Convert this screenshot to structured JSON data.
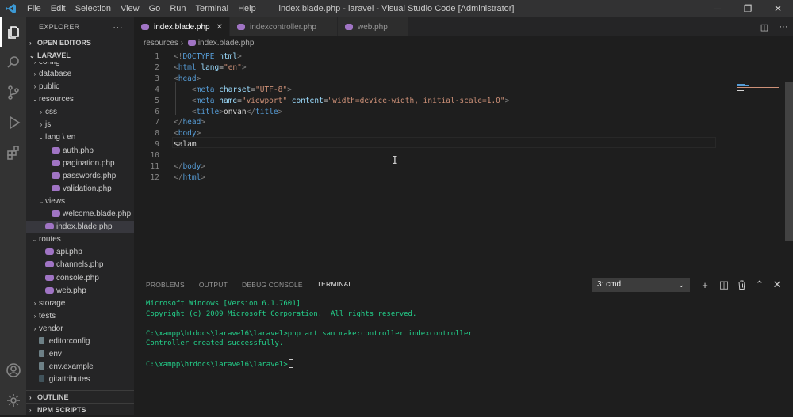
{
  "titlebar": {
    "title": "index.blade.php - laravel - Visual Studio Code [Administrator]",
    "menu": [
      "File",
      "Edit",
      "Selection",
      "View",
      "Go",
      "Run",
      "Terminal",
      "Help"
    ]
  },
  "activity": {
    "icons": [
      "explorer-icon",
      "search-icon",
      "source-control-icon",
      "run-debug-icon",
      "extensions-icon"
    ],
    "bottom_icons": [
      "account-icon",
      "settings-gear-icon"
    ]
  },
  "sidebar": {
    "header": "EXPLORER",
    "more": "···",
    "open_editors": "OPEN EDITORS",
    "project": "LARAVEL",
    "tree": [
      {
        "label": "config",
        "indent": 1,
        "type": "folder",
        "open": false,
        "partial": true
      },
      {
        "label": "database",
        "indent": 1,
        "type": "folder",
        "open": false
      },
      {
        "label": "public",
        "indent": 1,
        "type": "folder",
        "open": false
      },
      {
        "label": "resources",
        "indent": 1,
        "type": "folder",
        "open": true
      },
      {
        "label": "css",
        "indent": 2,
        "type": "folder",
        "open": false
      },
      {
        "label": "js",
        "indent": 2,
        "type": "folder",
        "open": false
      },
      {
        "label": "lang \\ en",
        "indent": 2,
        "type": "folder",
        "open": true
      },
      {
        "label": "auth.php",
        "indent": 3,
        "type": "php"
      },
      {
        "label": "pagination.php",
        "indent": 3,
        "type": "php"
      },
      {
        "label": "passwords.php",
        "indent": 3,
        "type": "php"
      },
      {
        "label": "validation.php",
        "indent": 3,
        "type": "php"
      },
      {
        "label": "views",
        "indent": 2,
        "type": "folder",
        "open": true
      },
      {
        "label": "welcome.blade.php",
        "indent": 3,
        "type": "php"
      },
      {
        "label": "index.blade.php",
        "indent": 2,
        "type": "php",
        "selected": true
      },
      {
        "label": "routes",
        "indent": 1,
        "type": "folder",
        "open": true
      },
      {
        "label": "api.php",
        "indent": 2,
        "type": "php"
      },
      {
        "label": "channels.php",
        "indent": 2,
        "type": "php"
      },
      {
        "label": "console.php",
        "indent": 2,
        "type": "php"
      },
      {
        "label": "web.php",
        "indent": 2,
        "type": "php"
      },
      {
        "label": "storage",
        "indent": 1,
        "type": "folder",
        "open": false
      },
      {
        "label": "tests",
        "indent": 1,
        "type": "folder",
        "open": false
      },
      {
        "label": "vendor",
        "indent": 1,
        "type": "folder",
        "open": false
      },
      {
        "label": ".editorconfig",
        "indent": 1,
        "type": "gear"
      },
      {
        "label": ".env",
        "indent": 1,
        "type": "gear"
      },
      {
        "label": ".env.example",
        "indent": 1,
        "type": "file"
      },
      {
        "label": ".gitattributes",
        "indent": 1,
        "type": "git"
      }
    ],
    "outline": "OUTLINE",
    "npm": "NPM SCRIPTS"
  },
  "tabs": [
    {
      "label": "index.blade.php",
      "active": true,
      "close": "✕"
    },
    {
      "label": "indexcontroller.php",
      "active": false
    },
    {
      "label": "web.php",
      "active": false
    }
  ],
  "breadcrumbs": {
    "folder": "resources",
    "sep": "›",
    "file": "index.blade.php"
  },
  "code_lines": [
    [
      {
        "c": "p",
        "t": "<!"
      },
      {
        "c": "t",
        "t": "DOCTYPE"
      },
      {
        "c": "a",
        "t": " html"
      },
      {
        "c": "p",
        "t": ">"
      }
    ],
    [
      {
        "c": "p",
        "t": "<"
      },
      {
        "c": "t",
        "t": "html"
      },
      {
        "c": "a",
        "t": " lang"
      },
      {
        "c": "tx",
        "t": "="
      },
      {
        "c": "s",
        "t": "\"en\""
      },
      {
        "c": "p",
        "t": ">"
      }
    ],
    [
      {
        "c": "p",
        "t": "<"
      },
      {
        "c": "t",
        "t": "head"
      },
      {
        "c": "p",
        "t": ">"
      }
    ],
    [
      {
        "c": "tx",
        "t": "    "
      },
      {
        "c": "p",
        "t": "<"
      },
      {
        "c": "t",
        "t": "meta"
      },
      {
        "c": "a",
        "t": " charset"
      },
      {
        "c": "tx",
        "t": "="
      },
      {
        "c": "s",
        "t": "\"UTF-8\""
      },
      {
        "c": "p",
        "t": ">"
      }
    ],
    [
      {
        "c": "tx",
        "t": "    "
      },
      {
        "c": "p",
        "t": "<"
      },
      {
        "c": "t",
        "t": "meta"
      },
      {
        "c": "a",
        "t": " name"
      },
      {
        "c": "tx",
        "t": "="
      },
      {
        "c": "s",
        "t": "\"viewport\""
      },
      {
        "c": "a",
        "t": " content"
      },
      {
        "c": "tx",
        "t": "="
      },
      {
        "c": "s",
        "t": "\"width=device-width, initial-scale=1.0\""
      },
      {
        "c": "p",
        "t": ">"
      }
    ],
    [
      {
        "c": "tx",
        "t": "    "
      },
      {
        "c": "p",
        "t": "<"
      },
      {
        "c": "t",
        "t": "title"
      },
      {
        "c": "p",
        "t": ">"
      },
      {
        "c": "tx",
        "t": "onvan"
      },
      {
        "c": "p",
        "t": "</"
      },
      {
        "c": "t",
        "t": "title"
      },
      {
        "c": "p",
        "t": ">"
      }
    ],
    [
      {
        "c": "p",
        "t": "</"
      },
      {
        "c": "t",
        "t": "head"
      },
      {
        "c": "p",
        "t": ">"
      }
    ],
    [
      {
        "c": "p",
        "t": "<"
      },
      {
        "c": "t",
        "t": "body"
      },
      {
        "c": "p",
        "t": ">"
      }
    ],
    [
      {
        "c": "tx",
        "t": "salam"
      }
    ],
    [],
    [
      {
        "c": "p",
        "t": "</"
      },
      {
        "c": "t",
        "t": "body"
      },
      {
        "c": "p",
        "t": ">"
      }
    ],
    [
      {
        "c": "p",
        "t": "</"
      },
      {
        "c": "t",
        "t": "html"
      },
      {
        "c": "p",
        "t": ">"
      }
    ]
  ],
  "panel": {
    "tabs": [
      "PROBLEMS",
      "OUTPUT",
      "DEBUG CONSOLE",
      "TERMINAL"
    ],
    "active_tab": "TERMINAL",
    "terminal_select": "3: cmd",
    "actions": [
      "+",
      "◫",
      "🗑",
      "⌃",
      "✕"
    ],
    "terminal_lines": [
      "Microsoft Windows [Version 6.1.7601]",
      "Copyright (c) 2009 Microsoft Corporation.  All rights reserved.",
      "",
      "C:\\xampp\\htdocs\\laravel6\\laravel>php artisan make:controller indexcontroller",
      "Controller created successfully.",
      "",
      "C:\\xampp\\htdocs\\laravel6\\laravel>"
    ]
  },
  "colors": {
    "php_icon": "#a074c4",
    "terminal_text": "#23d18b",
    "accent": "#007acc"
  }
}
